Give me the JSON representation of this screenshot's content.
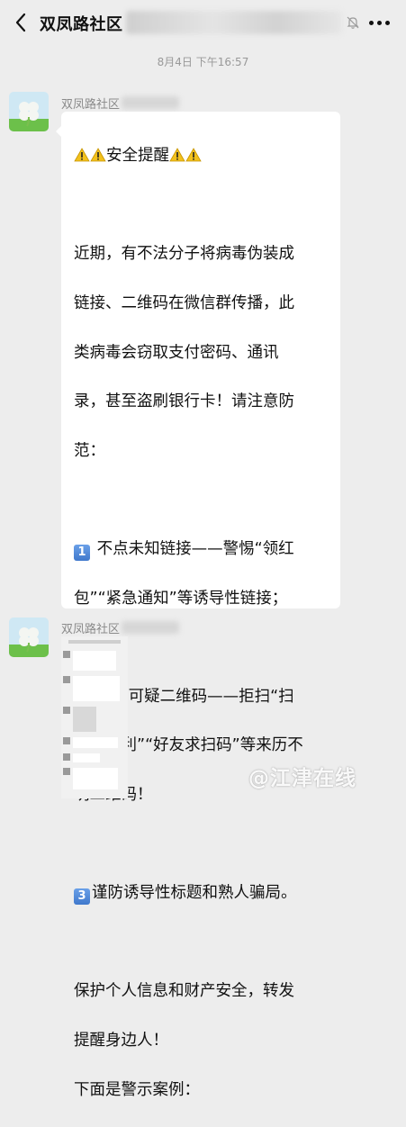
{
  "header": {
    "title": "双凤路社区",
    "back_icon": "chevron-left-icon",
    "mute_icon": "bell-off-icon",
    "more_icon": "more-dots-icon"
  },
  "chat": {
    "timestamp": "8月4日 下午16:57",
    "messages": [
      {
        "sender": "双凤路社区",
        "sender_suffix": "网格员",
        "title": "安全提醒",
        "lines": [
          "近期，有不法分子将病毒伪装成",
          "链接、二维码在微信群传播，此",
          "类病毒会窃取支付密码、通讯",
          "录，甚至盗刷银行卡！请注意防",
          "范：",
          "",
          "不点未知链接——警惕“领红",
          "包”“紧急通知”等诱导性链接；",
          "",
          "不扫可疑二维码——拒扫“扫",
          "码领福利”“好友求扫码”等来历不",
          "明二维码！",
          "",
          "谨防诱导性标题和熟人骗局。",
          "",
          "保护个人信息和财产安全，转发",
          "提醒身边人！",
          "下面是警示案例："
        ],
        "keycaps": [
          "1",
          "2",
          "3"
        ]
      },
      {
        "sender": "双凤路社区",
        "sender_suffix": "网格员",
        "type": "image"
      }
    ]
  },
  "watermark": "@江津在线",
  "colors": {
    "bg": "#ededed",
    "bubble": "#ffffff",
    "muted": "#999999"
  }
}
